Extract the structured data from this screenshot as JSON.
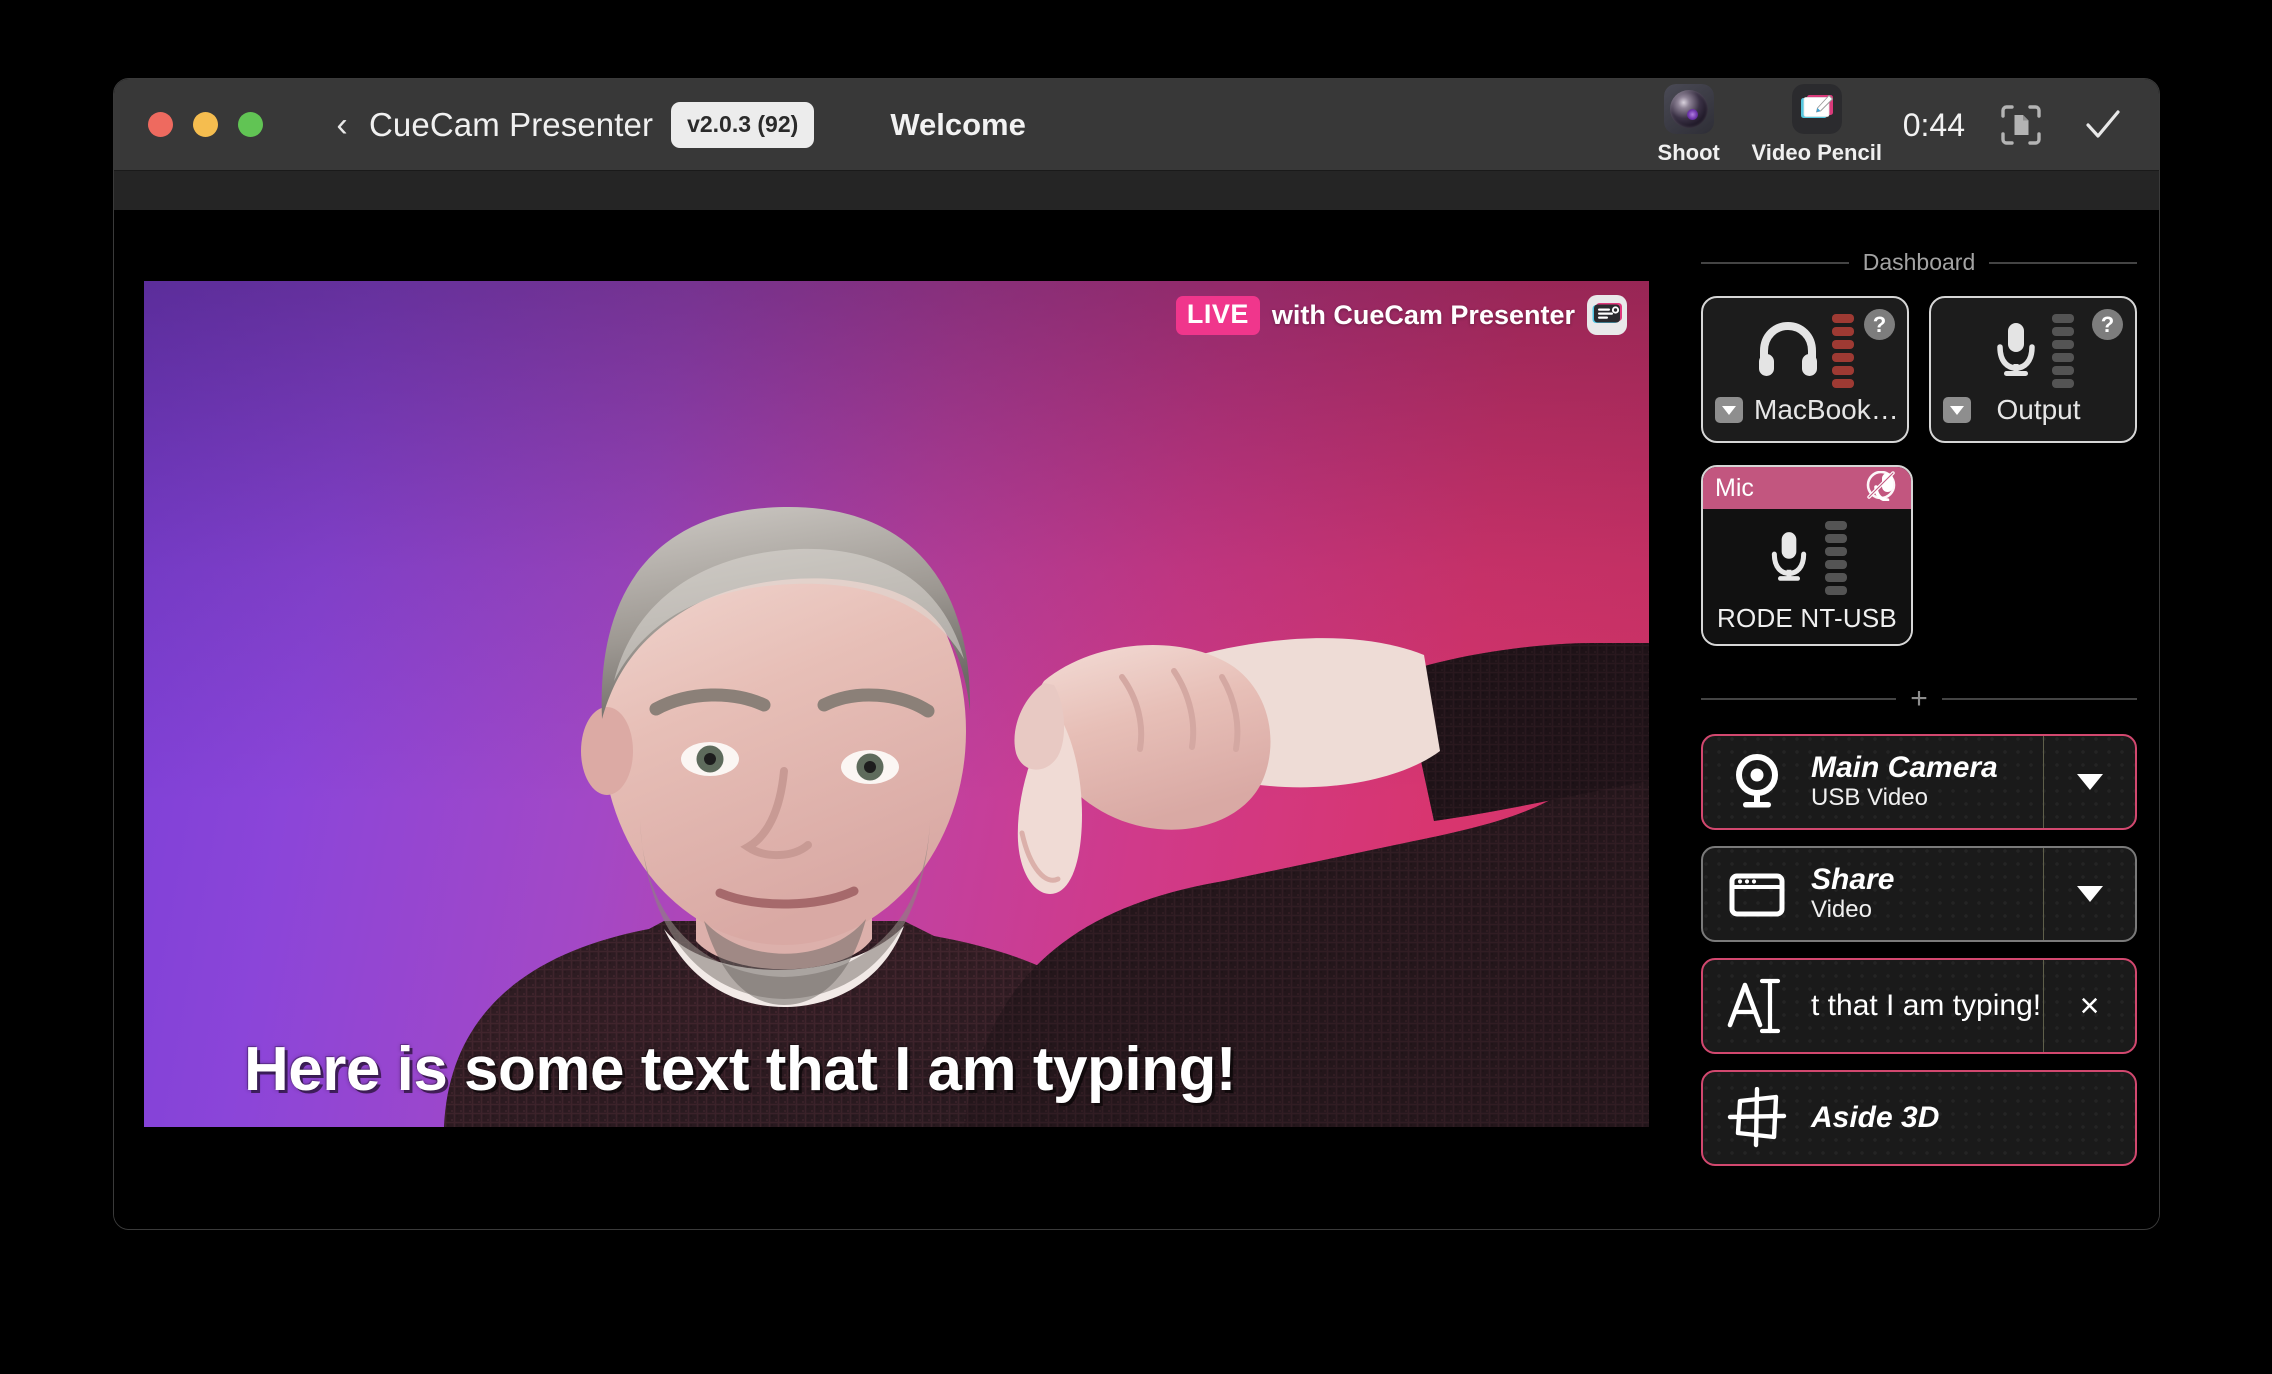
{
  "window": {
    "traffic_lights": [
      "close",
      "minimize",
      "maximize"
    ]
  },
  "titlebar": {
    "back_chevron": "‹",
    "app_title": "CueCam Presenter",
    "version_badge": "v2.0.3 (92)",
    "document_title": "Welcome",
    "tools": [
      {
        "icon": "camera-lens-icon",
        "label": "Shoot"
      },
      {
        "icon": "video-pencil-icon",
        "label": "Video Pencil"
      }
    ],
    "timer": "0:44",
    "capture_icon": "capture-document-icon",
    "confirm_icon": "checkmark-icon"
  },
  "video": {
    "live_chip": "LIVE",
    "live_text": "with CueCam Presenter",
    "app_icon": "cuecam-app-icon",
    "caption": "Here is some text that I am typing!",
    "background_gradient": {
      "from": "#7b3fd6",
      "mid": "#bf42a4",
      "to": "#d53468"
    }
  },
  "dashboard": {
    "section_label": "Dashboard",
    "add_source_label": "+",
    "devices": [
      {
        "icon": "headphones-icon",
        "name": "MacBook…",
        "help": "?",
        "meter_level": "red",
        "meter_segments": 6,
        "caret": "dropdown-caret"
      },
      {
        "icon": "microphone-icon",
        "name": "Output",
        "help": "?",
        "meter_level": "gray",
        "meter_segments": 6,
        "caret": "dropdown-caret"
      }
    ],
    "mic_card": {
      "header_label": "Mic",
      "mute_icon": "mic-muted-slash-icon",
      "icon": "microphone-icon",
      "device_name": "RODE NT-USB",
      "meter_segments": 6,
      "header_color": "#c2567f"
    },
    "sources": [
      {
        "icon": "webcam-icon",
        "title": "Main Camera",
        "subtitle": "USB Video",
        "action": "caret",
        "active": true
      },
      {
        "icon": "screen-share-icon",
        "title": "Share",
        "subtitle": "Video",
        "action": "caret",
        "active": false
      },
      {
        "icon": "text-cursor-icon",
        "title": "t that I am typing!",
        "subtitle": "",
        "action": "close",
        "active": true
      },
      {
        "icon": "aside-3d-icon",
        "title": "Aside 3D",
        "subtitle": "",
        "action": "none",
        "active": true
      }
    ]
  },
  "colors": {
    "accent_pink": "#d2486f",
    "live_pink": "#f0368c",
    "titlebar_bg": "#383838",
    "panel_bg": "#000000"
  }
}
